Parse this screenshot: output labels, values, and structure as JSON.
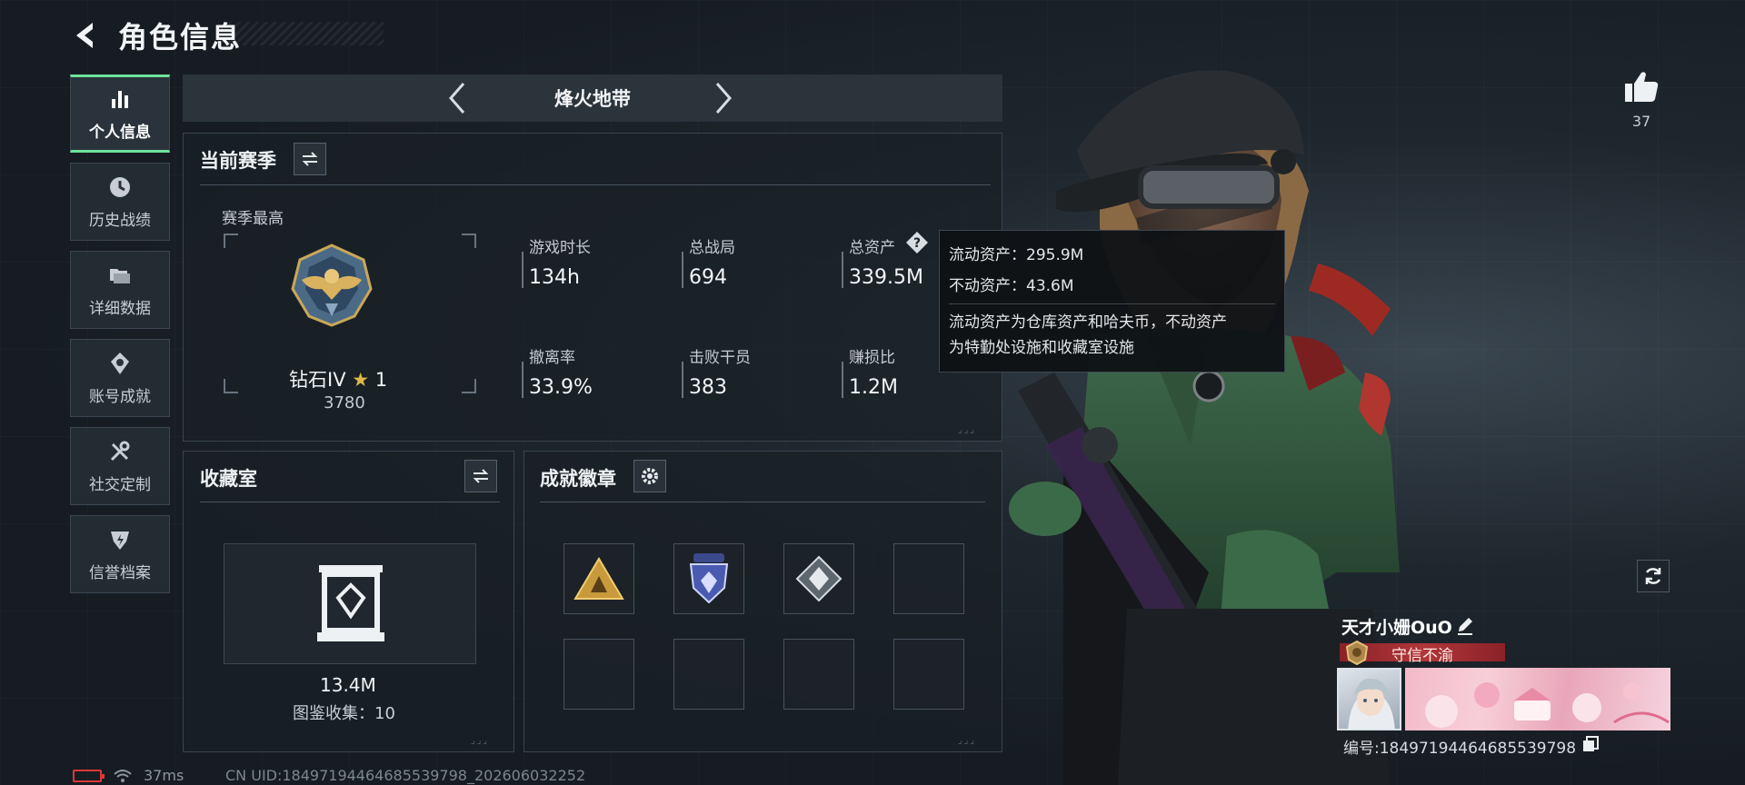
{
  "header": {
    "title": "角色信息"
  },
  "sidebar": {
    "items": [
      {
        "label": "个人信息",
        "icon": "bar-chart-icon",
        "active": true
      },
      {
        "label": "历史战绩",
        "icon": "clock-icon",
        "active": false
      },
      {
        "label": "详细数据",
        "icon": "folder-icon",
        "active": false
      },
      {
        "label": "账号成就",
        "icon": "achievement-icon",
        "active": false
      },
      {
        "label": "社交定制",
        "icon": "tools-icon",
        "active": false
      },
      {
        "label": "信誉档案",
        "icon": "shield-icon",
        "active": false
      }
    ]
  },
  "mode": {
    "title": "烽火地带"
  },
  "season": {
    "title": "当前赛季",
    "peak_label": "赛季最高",
    "rank_name": "钻石IV",
    "rank_stars": "1",
    "rank_score": "3780",
    "stats": [
      {
        "label": "游戏时长",
        "value": "134h"
      },
      {
        "label": "总战局",
        "value": "694"
      },
      {
        "label": "总资产",
        "value": "339.5M"
      },
      {
        "label": "撤离率",
        "value": "33.9%"
      },
      {
        "label": "击败干员",
        "value": "383"
      },
      {
        "label": "赚损比",
        "value": "1.2M"
      }
    ]
  },
  "tooltip": {
    "liquid": "流动资产：295.9M",
    "fixed": "不动资产：43.6M",
    "desc_line1": "流动资产为仓库资产和哈夫币，不动资产",
    "desc_line2": "为特勤处设施和收藏室设施"
  },
  "vault": {
    "title": "收藏室",
    "value": "13.4M",
    "collection": "图鉴收集：10"
  },
  "badges": {
    "title": "成就徽章",
    "slots": [
      "gold-triangle-badge",
      "blue-shield-badge",
      "silver-diamond-badge",
      "",
      "",
      "",
      "",
      ""
    ]
  },
  "profile": {
    "likes": "37",
    "name": "天才小姗OuO",
    "title": "守信不渝",
    "id": "编号:18497194464685539798"
  },
  "status": {
    "ping": "37ms",
    "uid": "CN UID:18497194464685539798_202606032252"
  },
  "colors": {
    "accent_green": "#6ee39b",
    "tooltip_bg": "#0e1114",
    "title_red": "#b1363a",
    "battery_red": "#d9383a"
  }
}
